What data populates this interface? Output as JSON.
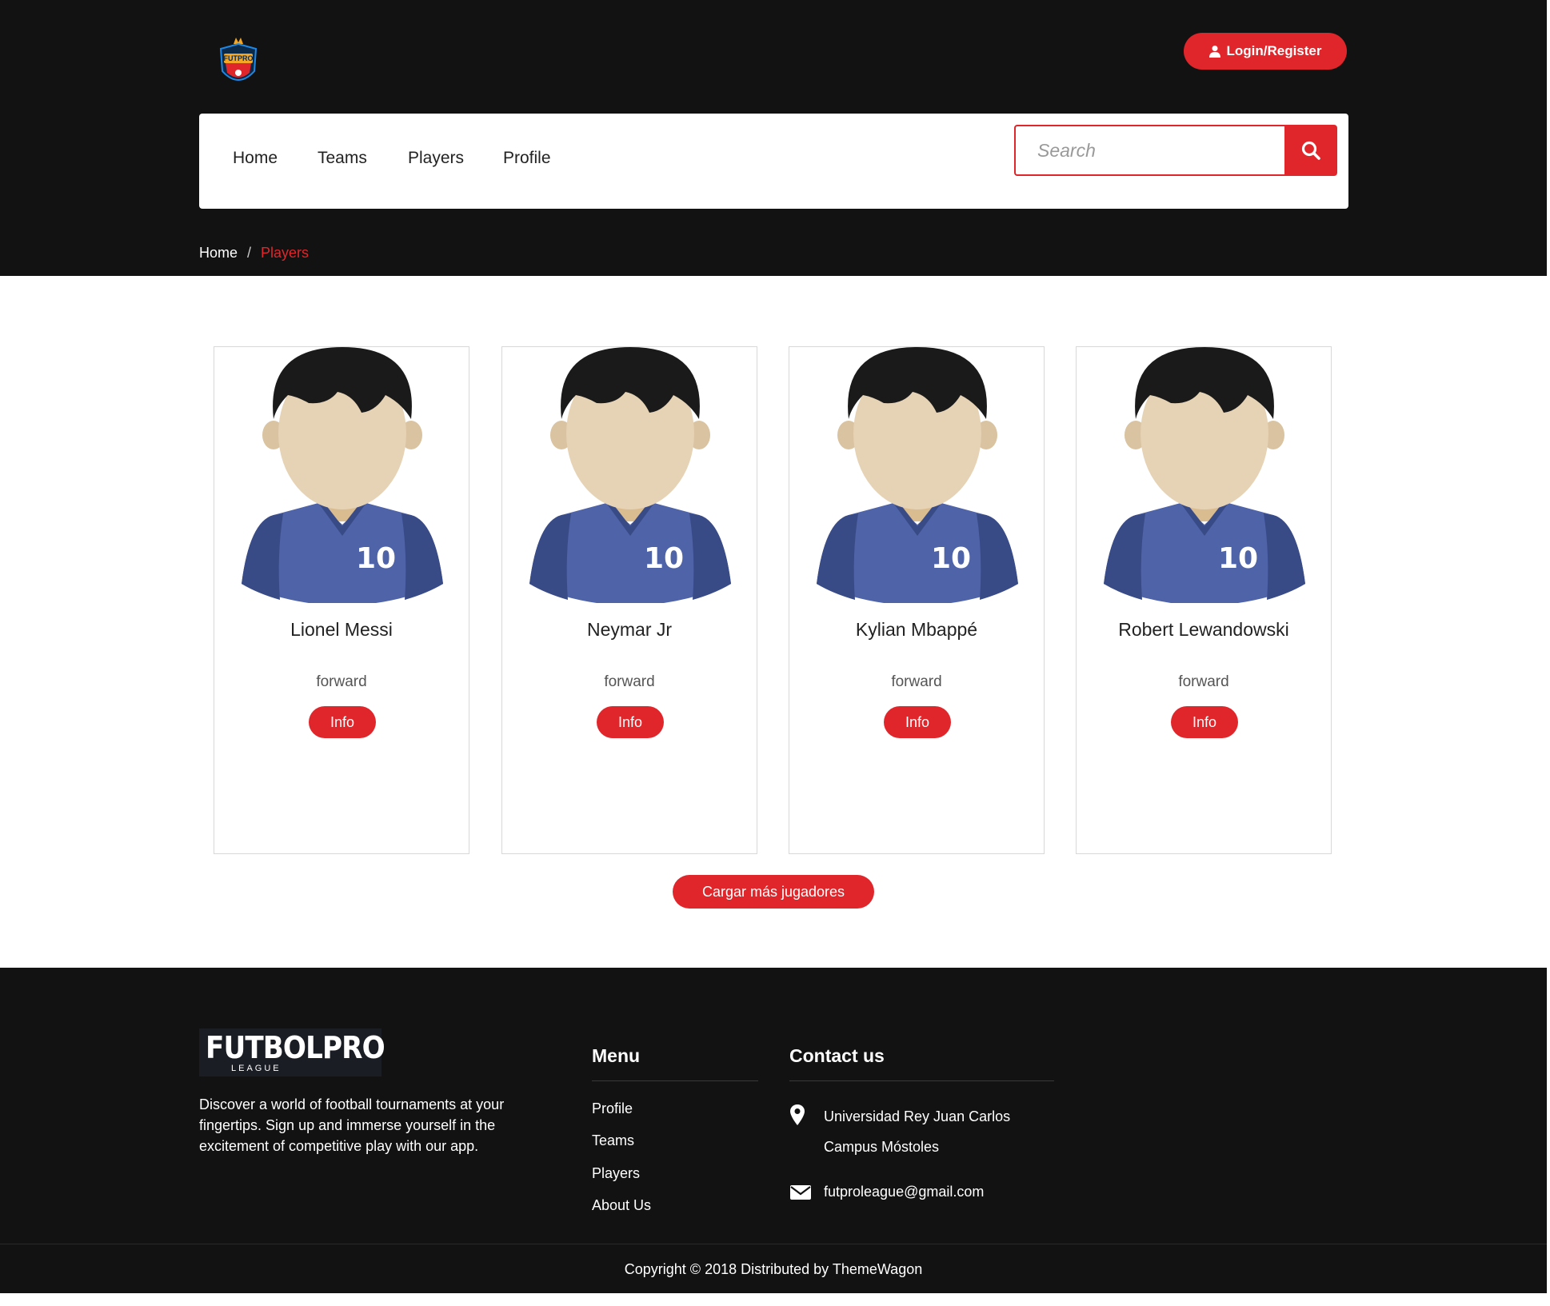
{
  "header": {
    "login_label": "Login/Register",
    "nav": [
      "Home",
      "Teams",
      "Players",
      "Profile"
    ],
    "search_placeholder": "Search",
    "breadcrumb": {
      "home": "Home",
      "separator": "/",
      "current": "Players"
    }
  },
  "players": [
    {
      "name": "Lionel Messi",
      "position": "forward",
      "number": "10",
      "button": "Info"
    },
    {
      "name": "Neymar Jr",
      "position": "forward",
      "number": "10",
      "button": "Info"
    },
    {
      "name": "Kylian Mbappé",
      "position": "forward",
      "number": "10",
      "button": "Info"
    },
    {
      "name": "Robert Lewandowski",
      "position": "forward",
      "number": "10",
      "button": "Info"
    }
  ],
  "load_more_label": "Cargar más jugadores",
  "footer": {
    "logo_text": "FUTBOLPRO",
    "logo_sub": "LEAGUE",
    "description": "Discover a world of football tournaments at your fingertips. Sign up and immerse yourself in the excitement of competitive play with our app.",
    "menu_title": "Menu",
    "menu": [
      "Profile",
      "Teams",
      "Players",
      "About Us"
    ],
    "contact_title": "Contact us",
    "address_line1": "Universidad Rey Juan Carlos",
    "address_line2": "Campus Móstoles",
    "email": "futproleague@gmail.com",
    "copyright": "Copyright © 2018 Distributed by ThemeWagon"
  },
  "colors": {
    "accent": "#e0262b",
    "header_bg": "#121212",
    "jersey": "#4f63a8",
    "jersey_dark": "#394b87",
    "skin": "#e6d3b5",
    "hair": "#1a1a1a"
  },
  "icons": {
    "logo": "futpro-shield-logo",
    "login": "user-icon",
    "search": "search-icon",
    "location": "location-pin-icon",
    "email": "envelope-icon"
  }
}
